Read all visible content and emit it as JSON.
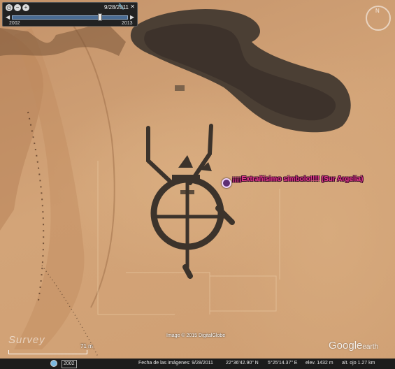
{
  "time_slider": {
    "date": "9/28/2011",
    "start_year": "2002",
    "end_year": "2013",
    "position": 0.76,
    "prev_icon": "arrow-left-icon",
    "next_icon": "arrow-right-icon",
    "close_icon": "close-icon",
    "settings_icon": "wrench-icon"
  },
  "navigation": {
    "north_label": "N",
    "icon": "compass-ring-icon"
  },
  "placemark": {
    "label": "¡¡¡¡Extrañísimo símbolo!!!! (Sur Argelia)",
    "icon": "placemark-info-icon",
    "color": "#e8388e"
  },
  "overlay": {
    "imagery_credit": "Image © 2015 DigitalGlobe",
    "survey_logo": "Survey",
    "scale_label": "71 m",
    "brand": "Google",
    "brand_suffix": "earth"
  },
  "status_bar": {
    "imagery_year": "2002",
    "imagery_date": "Fecha de las imágenes: 9/28/2011",
    "latitude": "22°36'42.90\" N",
    "longitude": "5°25'14.37\" E",
    "elevation": "elev. 1432 m",
    "eye_altitude": "alt. ojo  1.27 km"
  }
}
